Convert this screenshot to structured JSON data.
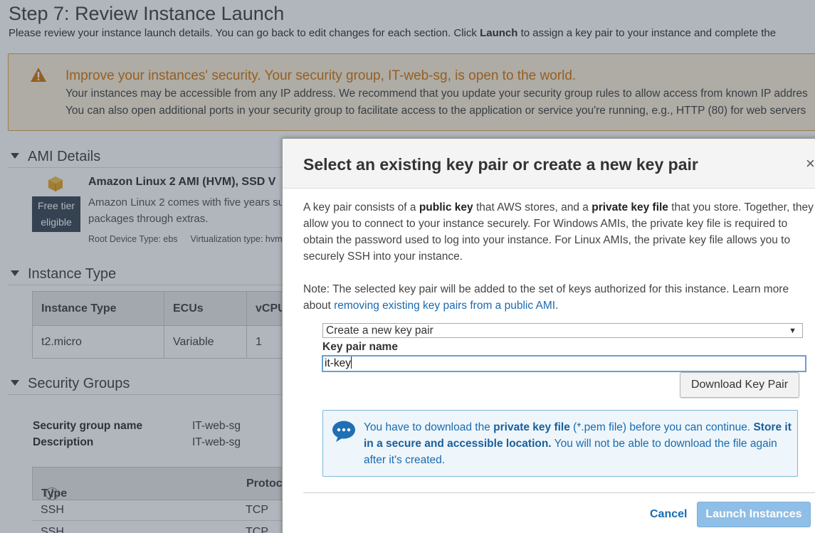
{
  "page": {
    "title": "Step 7: Review Instance Launch",
    "subtitle_before": "Please review your instance launch details. You can go back to edit changes for each section. Click",
    "subtitle_bold": "Launch",
    "subtitle_after": "to assign a key pair to your instance and complete the"
  },
  "warning": {
    "title": "Improve your instances' security. Your security group, IT-web-sg, is open to the world.",
    "line1": "Your instances may be accessible from any IP address. We recommend that you update your security group rules to allow access from known IP addres",
    "line2": "You can also open additional ports in your security group to facilitate access to the application or service you're running, e.g., HTTP (80) for web servers"
  },
  "ami": {
    "heading": "AMI Details",
    "name": "Amazon Linux 2 AMI (HVM), SSD V",
    "free_tier_line1": "Free tier",
    "free_tier_line2": "eligible",
    "desc_line1": "Amazon Linux 2 comes with five years sup",
    "desc_line2": "packages through extras.",
    "root_device": "Root Device Type: ebs",
    "virtualization": "Virtualization type: hvm"
  },
  "instance_type": {
    "heading": "Instance Type",
    "columns": [
      "Instance Type",
      "ECUs",
      "vCPU"
    ],
    "row": [
      "t2.micro",
      "Variable",
      "1"
    ]
  },
  "security_groups": {
    "heading": "Security Groups",
    "name_label": "Security group name",
    "name_value": "IT-web-sg",
    "desc_label": "Description",
    "desc_value": "IT-web-sg",
    "columns": [
      "Type",
      "Protoc"
    ],
    "rows": [
      [
        "SSH",
        "TCP"
      ],
      [
        "SSH",
        "TCP"
      ]
    ]
  },
  "modal": {
    "title": "Select an existing key pair or create a new key pair",
    "close": "×",
    "p1_a": "A key pair consists of a",
    "p1_b": "public key",
    "p1_c": "that AWS stores, and a",
    "p1_d": "private key file",
    "p1_e": "that you store. Together, they allow you to connect to your instance securely. For Windows AMIs, the private key file is required to obtain the password used to log into your instance. For Linux AMIs, the private key file allows you to securely SSH into your instance.",
    "p2_a": "Note: The selected key pair will be added to the set of keys authorized for this instance. Learn more about",
    "p2_link": "removing existing key pairs from a public AMI",
    "p2_end": ".",
    "select_value": "Create a new key pair",
    "key_name_label": "Key pair name",
    "key_name_value": "it-key",
    "download_button": "Download Key Pair",
    "note_a": "You have to download the",
    "note_b": "private key file",
    "note_c": "(*.pem file) before you can continue.",
    "note_d": "Store it in a secure and accessible location.",
    "note_e": "You will not be able to download the file again after it's created.",
    "cancel": "Cancel",
    "launch": "Launch Instances"
  },
  "colors": {
    "warning_orange": "#d4770f",
    "link_blue": "#1a6aaf",
    "launch_disabled": "#8fbee6"
  }
}
